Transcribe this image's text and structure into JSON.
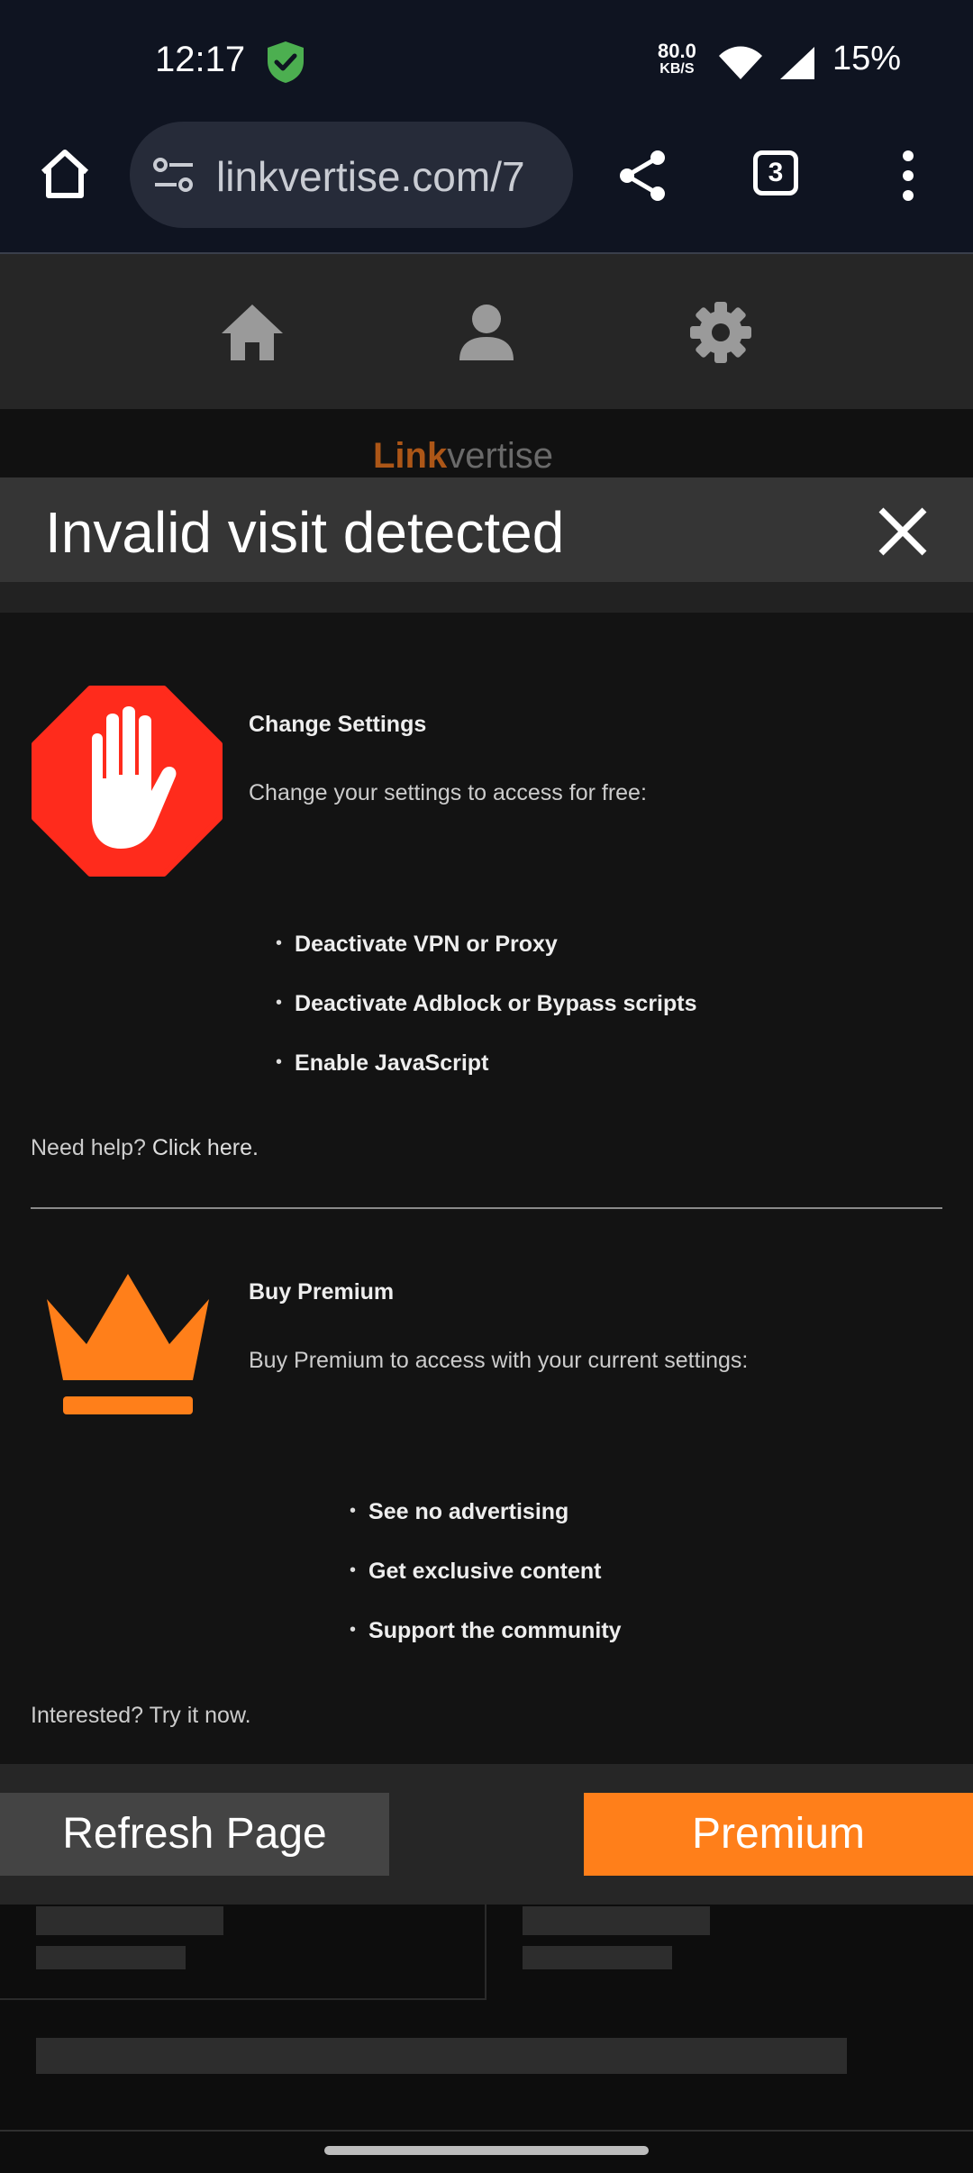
{
  "status_bar": {
    "time": "12:17",
    "speed_value": "80.0",
    "speed_unit": "KB/S",
    "battery": "15%"
  },
  "browser": {
    "url": "linkvertise.com/7",
    "tab_count": "3"
  },
  "logo": {
    "part1": "Link",
    "part2": "vertise"
  },
  "modal": {
    "title": "Invalid visit detected",
    "settings": {
      "title": "Change Settings",
      "description": "Change your settings to access for free:",
      "bullets": [
        "Deactivate VPN or Proxy",
        "Deactivate Adblock or Bypass scripts",
        "Enable JavaScript"
      ],
      "help_prefix": "Need help? ",
      "help_link": "Click here."
    },
    "premium": {
      "title": "Buy Premium",
      "description": "Buy Premium to access with your current settings:",
      "bullets": [
        "See no advertising",
        "Get exclusive content",
        "Support the community"
      ],
      "footer": "Interested? Try it now."
    }
  },
  "actions": {
    "refresh_label": "Refresh Page",
    "premium_label": "Premium"
  },
  "colors": {
    "accent_orange": "#ff7f1a",
    "stop_red": "#ff2b1c",
    "shield_green": "#4caf50",
    "background": "#131313"
  }
}
